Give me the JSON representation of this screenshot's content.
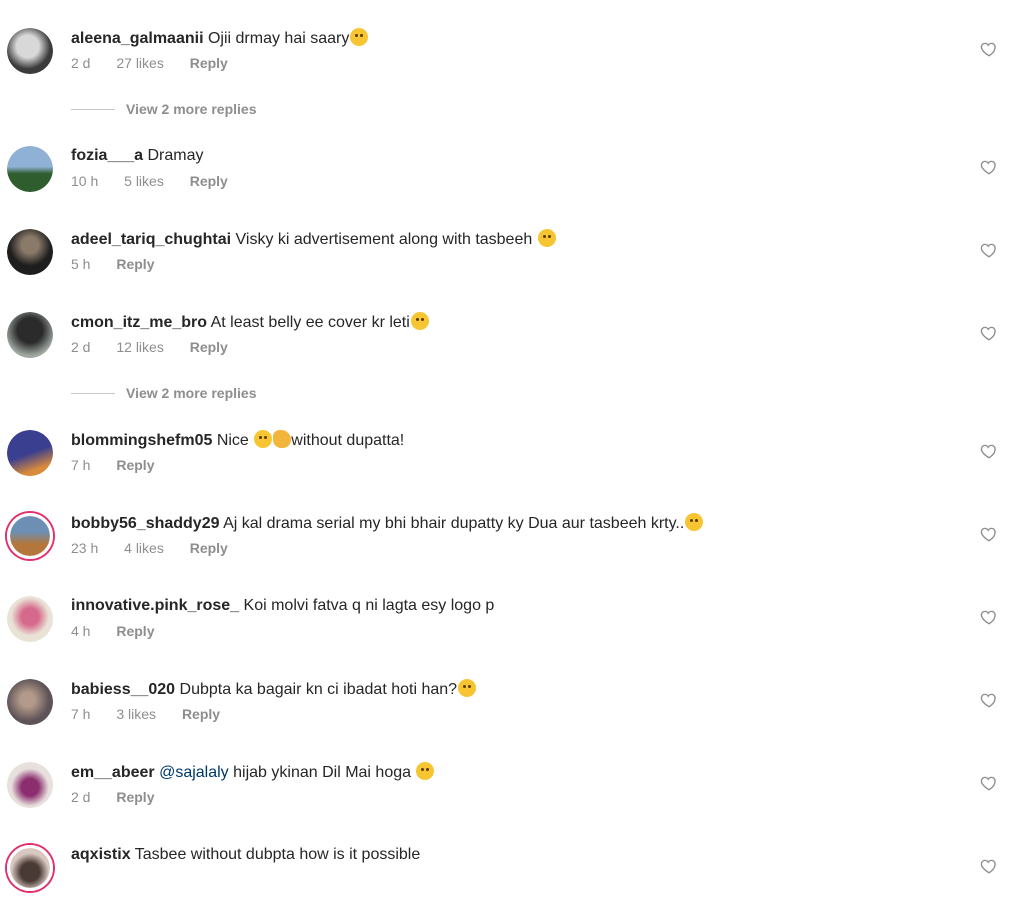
{
  "comments": [
    {
      "username": "aleena_galmaanii",
      "text": "Ojii drmay hai saary",
      "emoji": "grinning-sweat-emoji",
      "time": "2 d",
      "likes": "27 likes",
      "reply": "Reply",
      "avatar_colors": [
        "#3b3b3b",
        "#d8d8d8"
      ],
      "ring": false
    },
    {
      "username": "fozia___a",
      "text": "Dramay",
      "emoji": "",
      "time": "10 h",
      "likes": "5 likes",
      "reply": "Reply",
      "avatar_colors": [
        "#8fb1d6",
        "#2f5d2e"
      ],
      "ring": false
    },
    {
      "username": "adeel_tariq_chughtai",
      "text": "Visky ki advertisement along with tasbeeh",
      "emoji": "thinking-face-emoji",
      "time": "5 h",
      "likes": "",
      "reply": "Reply",
      "avatar_colors": [
        "#1e1e1e",
        "#8a7a6a"
      ],
      "ring": false
    },
    {
      "username": "cmon_itz_me_bro",
      "text": "At least belly ee cover kr leti",
      "emoji": "unamused-face-emoji",
      "time": "2 d",
      "likes": "12 likes",
      "reply": "Reply",
      "avatar_colors": [
        "#2b2b2b",
        "#9fa7a0"
      ],
      "ring": false
    },
    {
      "username": "blommingshefm05",
      "text": "Nice",
      "emoji": "grinning-sweat-clap-emoji",
      "text_after": "without dupatta!",
      "time": "7 h",
      "likes": "",
      "reply": "Reply",
      "avatar_colors": [
        "#3a3f8f",
        "#d98a3a"
      ],
      "ring": false
    },
    {
      "username": "bobby56_shaddy29",
      "text": "Aj kal drama serial my bhi bhair dupatty ky Dua aur tasbeeh krty..",
      "emoji": "pensive-face-emoji",
      "time": "23 h",
      "likes": "4 likes",
      "reply": "Reply",
      "avatar_colors": [
        "#6d8fb3",
        "#b4763a"
      ],
      "ring": true
    },
    {
      "username": "innovative.pink_rose_",
      "text": "Koi molvi fatva q ni lagta esy logo p",
      "emoji": "",
      "time": "4 h",
      "likes": "",
      "reply": "Reply",
      "avatar_colors": [
        "#e9e2d6",
        "#d66a8c"
      ],
      "ring": false
    },
    {
      "username": "babiess__020",
      "text": "Dubpta ka bagair kn ci ibadat hoti han?",
      "emoji": "grinning-sweat-emoji",
      "time": "7 h",
      "likes": "3 likes",
      "reply": "Reply",
      "avatar_colors": [
        "#5e5357",
        "#b39a8a"
      ],
      "ring": false
    },
    {
      "username": "em__abeer",
      "mention": "@sajalaly",
      "text": " hijab ykinan Dil Mai hoga",
      "emoji": "kissing-face-emoji",
      "time": "2 d",
      "likes": "",
      "reply": "Reply",
      "avatar_colors": [
        "#e7e0dc",
        "#8b2d6e"
      ],
      "ring": false
    },
    {
      "username": "aqxistix",
      "text": "Tasbee without dubpta how is it possible",
      "emoji": "",
      "time": "",
      "likes": "",
      "reply": "",
      "avatar_colors": [
        "#d8c8c0",
        "#4a3a35"
      ],
      "ring": true
    }
  ],
  "view_more": [
    {
      "label": "View 2 more replies"
    },
    {
      "label": "View 2 more replies"
    }
  ],
  "icons": {
    "like": "heart-icon"
  },
  "colors": {
    "username": "#262626",
    "meta": "#8e8e8e",
    "mention": "#00376b",
    "ring": "#e1306c"
  }
}
